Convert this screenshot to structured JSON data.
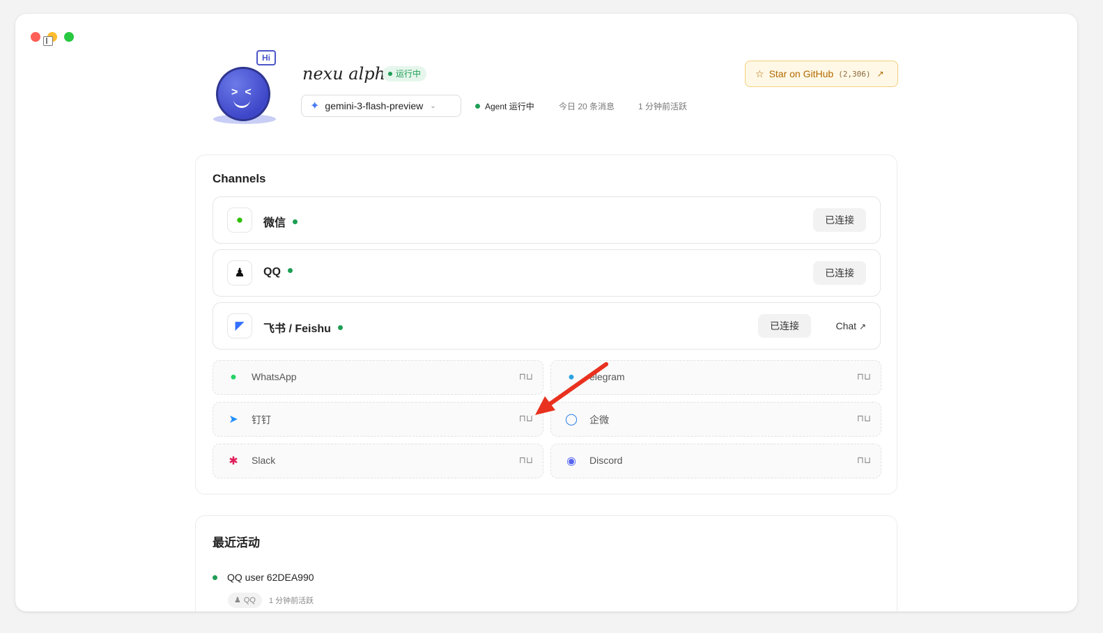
{
  "header": {
    "agent_name": "nexu alpha",
    "run_status": "运行中",
    "model": "gemini-3-flash-preview",
    "agent_status": "Agent 运行中",
    "messages_today": "今日 20 条消息",
    "last_active": "1 分钟前活跃",
    "avatar_bubble": "Hi",
    "github": {
      "label": "Star on GitHub",
      "count": "(2,306)"
    }
  },
  "channels": {
    "title": "Channels",
    "connected": [
      {
        "name": "微信",
        "status": "已连接",
        "icon": "wechat-icon"
      },
      {
        "name": "QQ",
        "status": "已连接",
        "icon": "qq-icon"
      },
      {
        "name": "飞书 / Feishu",
        "status": "已连接",
        "chat": "Chat",
        "icon": "feishu-icon"
      }
    ],
    "available": [
      {
        "name": "WhatsApp",
        "icon": "whatsapp-icon"
      },
      {
        "name": "elegram",
        "icon": "telegram-icon"
      },
      {
        "name": "钉钉",
        "icon": "dingtalk-icon"
      },
      {
        "name": "企微",
        "icon": "wecom-icon"
      },
      {
        "name": "Slack",
        "icon": "slack-icon"
      },
      {
        "name": "Discord",
        "icon": "discord-icon"
      }
    ]
  },
  "activity": {
    "title": "最近活动",
    "items": [
      {
        "user": "QQ user 62DEA990",
        "channel": "QQ",
        "time": "1 分钟前活跃"
      }
    ]
  },
  "colors": {
    "accent_green": "#1e9e55",
    "github_border": "#f2cf7a",
    "annotation_arrow": "#e8321f"
  }
}
